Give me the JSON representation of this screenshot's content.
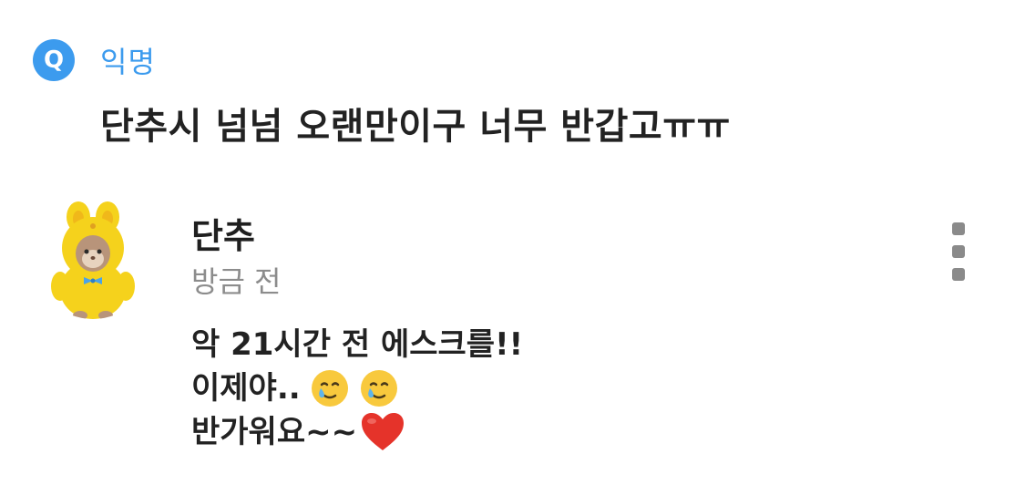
{
  "question": {
    "badge": "Q",
    "author": "익명",
    "text": "단추시 넘넘 오랜만이구 너무 반갑고ㅠㅠ"
  },
  "answer": {
    "name": "단추",
    "time": "방금 전",
    "lines": [
      "악 21시간 전 에스크를!!",
      "이제야..",
      "반가워요~~"
    ],
    "emojis": [
      "smiling-face-with-tear",
      "smiling-face-with-tear",
      "red-heart"
    ]
  },
  "colors": {
    "accent": "#3c9bee",
    "text": "#1f1f1f",
    "muted": "#8c8c8c",
    "avatar_costume": "#f5d21c"
  },
  "icons": {
    "more": "more-vertical-icon"
  }
}
